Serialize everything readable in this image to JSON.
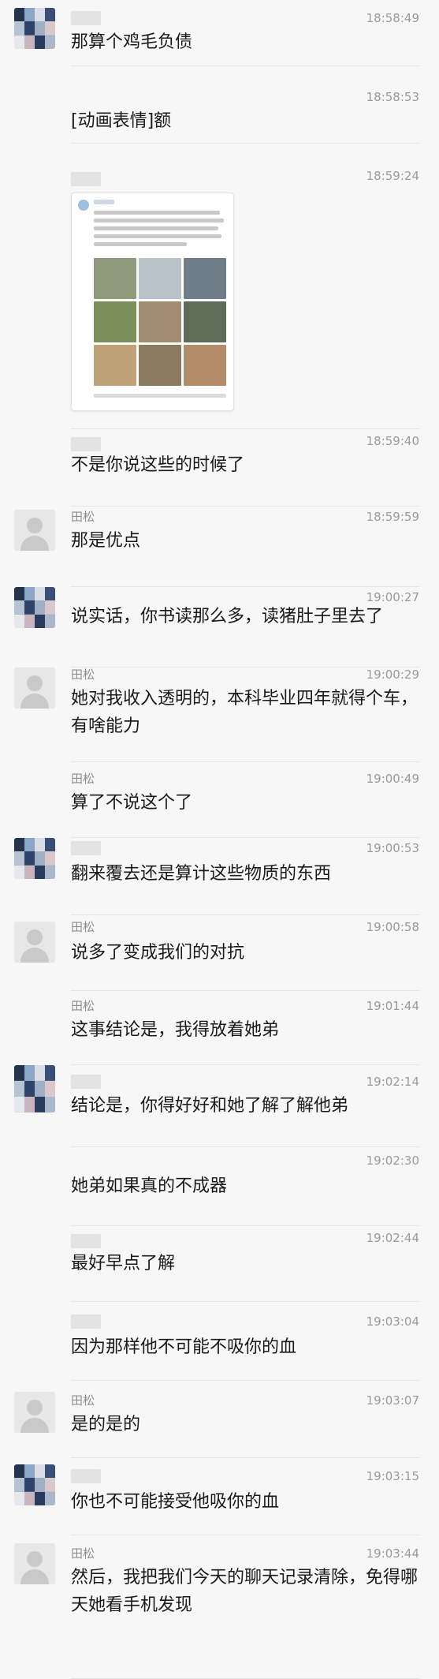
{
  "chat": {
    "messages": [
      {
        "sender": "",
        "time": "18:58:49",
        "text": "那算个鸡毛负债"
      },
      {
        "sender": "",
        "time": "18:58:53",
        "text": "[动画表情]额"
      },
      {
        "sender": "",
        "time": "18:59:24",
        "text": ""
      },
      {
        "sender": "",
        "time": "18:59:40",
        "text": "不是你说这些的时候了"
      },
      {
        "sender": "田松",
        "time": "18:59:59",
        "text": "那是优点"
      },
      {
        "sender": "",
        "time": "19:00:27",
        "text": "说实话，你书读那么多，读猪肚子里去了"
      },
      {
        "sender": "田松",
        "time": "19:00:29",
        "text": "她对我收入透明的，本科毕业四年就得个车，有啥能力"
      },
      {
        "sender": "田松",
        "time": "19:00:49",
        "text": "算了不说这个了"
      },
      {
        "sender": "",
        "time": "19:00:53",
        "text": "翻来覆去还是算计这些物质的东西"
      },
      {
        "sender": "田松",
        "time": "19:00:58",
        "text": "说多了变成我们的对抗"
      },
      {
        "sender": "田松",
        "time": "19:01:44",
        "text": "这事结论是，我得放着她弟"
      },
      {
        "sender": "",
        "time": "19:02:14",
        "text": "结论是，你得好好和她了解了解他弟"
      },
      {
        "sender": "",
        "time": "19:02:30",
        "text": "她弟如果真的不成器"
      },
      {
        "sender": "",
        "time": "19:02:44",
        "text": "最好早点了解"
      },
      {
        "sender": "",
        "time": "19:03:04",
        "text": "因为那样他不可能不吸你的血"
      },
      {
        "sender": "田松",
        "time": "19:03:07",
        "text": "是的是的"
      },
      {
        "sender": "",
        "time": "19:03:15",
        "text": "你也不可能接受他吸你的血"
      },
      {
        "sender": "田松",
        "time": "19:03:44",
        "text": "然后，我把我们今天的聊天记录清除，免得哪天她看手机发现"
      }
    ]
  },
  "colors": {
    "background": "#f7f7f7",
    "text": "#1a1a1a",
    "meta": "#9a9a9a",
    "divider": "#e6e6e6"
  },
  "icons": {
    "default_avatar": "person-silhouette-icon",
    "pixelated_avatar": "mosaic-avatar-icon"
  }
}
